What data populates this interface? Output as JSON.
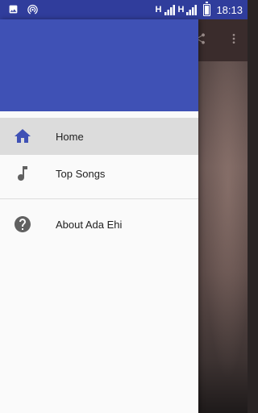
{
  "status_bar": {
    "network_1": "H",
    "network_2": "H",
    "time": "18:13"
  },
  "drawer": {
    "items": [
      {
        "label": "Home",
        "icon": "home-icon",
        "active": true
      },
      {
        "label": "Top Songs",
        "icon": "music-note-icon",
        "active": false
      }
    ],
    "secondary_items": [
      {
        "label": "About Ada Ehi",
        "icon": "help-circle-icon",
        "active": false
      }
    ]
  },
  "colors": {
    "status_bar": "#303d9c",
    "drawer_header": "#3f51b5",
    "active_icon": "#3f51b5",
    "active_row": "#dcdcdc"
  }
}
